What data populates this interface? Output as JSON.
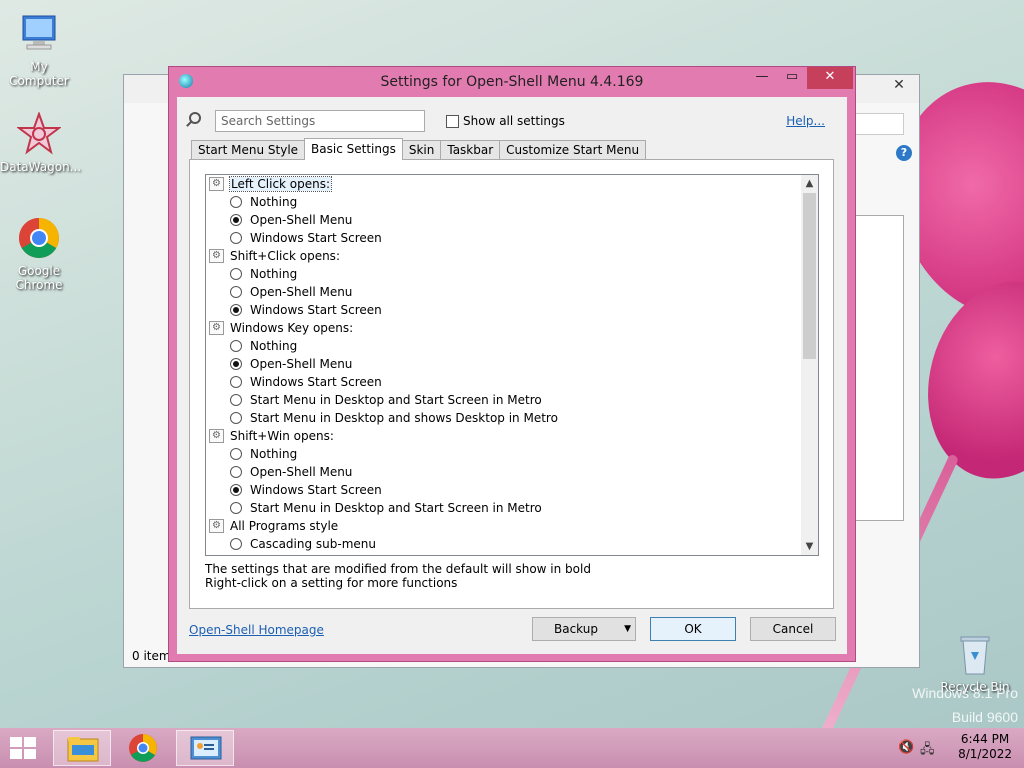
{
  "desktop": {
    "icons": [
      {
        "label": "My Computer"
      },
      {
        "label": "DataWagon..."
      },
      {
        "label": "Google Chrome"
      },
      {
        "label": "Recycle Bin"
      }
    ],
    "watermark_line1": "Windows 8.1 Pro",
    "watermark_line2": "Build 9600"
  },
  "background_window": {
    "status": "0 items"
  },
  "dialog": {
    "title": "Settings for Open-Shell Menu 4.4.169",
    "search_placeholder": "Search Settings",
    "show_all_label": "Show all settings",
    "help_label": "Help...",
    "tabs": [
      {
        "label": "Start Menu Style"
      },
      {
        "label": "Basic Settings"
      },
      {
        "label": "Skin"
      },
      {
        "label": "Taskbar"
      },
      {
        "label": "Customize Start Menu"
      }
    ],
    "active_tab": "Basic Settings",
    "settings": [
      {
        "type": "group",
        "label": "Left Click opens:",
        "selected": true
      },
      {
        "type": "option",
        "label": "Nothing",
        "checked": false
      },
      {
        "type": "option",
        "label": "Open-Shell Menu",
        "checked": true
      },
      {
        "type": "option",
        "label": "Windows Start Screen",
        "checked": false
      },
      {
        "type": "group",
        "label": "Shift+Click opens:"
      },
      {
        "type": "option",
        "label": "Nothing",
        "checked": false
      },
      {
        "type": "option",
        "label": "Open-Shell Menu",
        "checked": false
      },
      {
        "type": "option",
        "label": "Windows Start Screen",
        "checked": true
      },
      {
        "type": "group",
        "label": "Windows Key opens:"
      },
      {
        "type": "option",
        "label": "Nothing",
        "checked": false
      },
      {
        "type": "option",
        "label": "Open-Shell Menu",
        "checked": true
      },
      {
        "type": "option",
        "label": "Windows Start Screen",
        "checked": false
      },
      {
        "type": "option",
        "label": "Start Menu in Desktop and Start Screen in Metro",
        "checked": false
      },
      {
        "type": "option",
        "label": "Start Menu in Desktop and shows Desktop in Metro",
        "checked": false
      },
      {
        "type": "group",
        "label": "Shift+Win opens:"
      },
      {
        "type": "option",
        "label": "Nothing",
        "checked": false
      },
      {
        "type": "option",
        "label": "Open-Shell Menu",
        "checked": false
      },
      {
        "type": "option",
        "label": "Windows Start Screen",
        "checked": true
      },
      {
        "type": "option",
        "label": "Start Menu in Desktop and Start Screen in Metro",
        "checked": false
      },
      {
        "type": "group",
        "label": "All Programs style"
      },
      {
        "type": "option",
        "label": "Cascading sub-menu",
        "checked": false
      }
    ],
    "note_line1": "The settings that are modified from the default will show in bold",
    "note_line2": "Right-click on a setting for more functions",
    "homepage_link": "Open-Shell Homepage",
    "backup_label": "Backup",
    "ok_label": "OK",
    "cancel_label": "Cancel"
  },
  "taskbar": {
    "time": "6:44 PM",
    "date": "8/1/2022"
  },
  "colors": {
    "dialog_frame": "#e27bb0",
    "close_button": "#c7405b",
    "link": "#1b5fb3",
    "taskbar": "#d3a0bd"
  }
}
